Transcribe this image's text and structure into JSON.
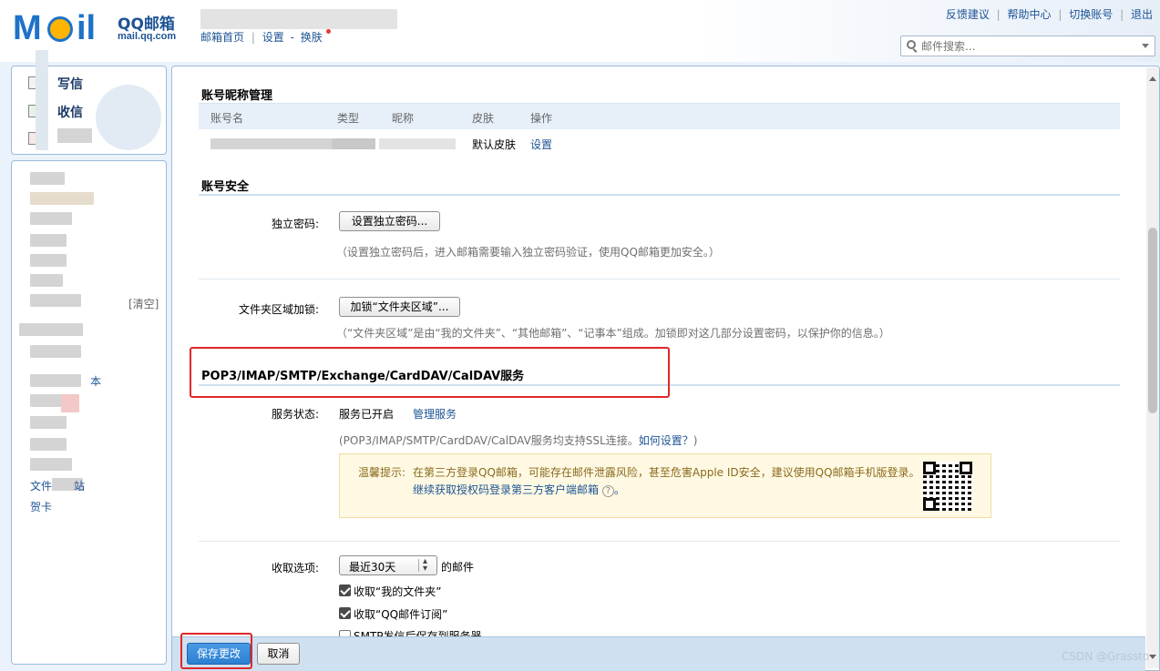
{
  "header": {
    "logo_mail": "M",
    "logo_il": "il",
    "brand": "QQ邮箱",
    "brand_domain": "mail.qq.com",
    "nav_home": "邮箱首页",
    "nav_sep": "|",
    "nav_settings": "设置",
    "nav_dash": "-",
    "nav_skin": "换肤",
    "top_links": [
      "反馈建议",
      "帮助中心",
      "切换账号",
      "退出"
    ],
    "search_placeholder": "邮件搜索..."
  },
  "sidebar": {
    "write": "写信",
    "receive": "收信",
    "clear": "[清空]",
    "notes_suffix": "本",
    "trash_prefix": "文件",
    "trash_suffix": "站",
    "greeting_card": "贺卡"
  },
  "account_nick": {
    "title": "账号昵称管理",
    "headers": [
      "账号名",
      "类型",
      "昵称",
      "皮肤",
      "操作"
    ],
    "skin": "默认皮肤",
    "action": "设置"
  },
  "security": {
    "title": "账号安全",
    "pwd_label": "独立密码:",
    "pwd_button": "设置独立密码...",
    "pwd_hint": "（设置独立密码后，进入邮箱需要输入独立密码验证，使用QQ邮箱更加安全。）",
    "lock_label": "文件夹区域加锁:",
    "lock_button": "加锁“文件夹区域”...",
    "lock_hint": "（“文件夹区域”是由“我的文件夹”、“其他邮箱”、“记事本”组成。加锁即对这几部分设置密码，以保护你的信息。）"
  },
  "pop3": {
    "title": "POP3/IMAP/SMTP/Exchange/CardDAV/CalDAV服务",
    "status_label": "服务状态:",
    "status_value": "服务已开启",
    "manage_link": "管理服务",
    "ssl_hint_prefix": "(POP3/IMAP/SMTP/CardDAV/CalDAV服务均支持SSL连接。",
    "ssl_hint_link": "如何设置？",
    "ssl_hint_suffix": ")",
    "warn_prefix": "温馨提示:",
    "warn_text": "在第三方登录QQ邮箱，可能存在邮件泄露风险，甚至危害Apple ID安全，建议使用QQ邮箱手机版登录。",
    "warn_link": "继续获取授权码登录第三方客户端邮箱",
    "warn_help": "?",
    "warn_end": "。",
    "fetch_label": "收取选项:",
    "fetch_select": "最近30天",
    "fetch_suffix": "的邮件",
    "check1": "收取“我的文件夹”",
    "check2": "收取“QQ邮件订阅”",
    "check3": "SMTP发信后保存到服务器"
  },
  "footer": {
    "save": "保存更改",
    "cancel": "取消",
    "watermark": "CSDN @Grassto"
  },
  "colors": {
    "accent": "#1e5494",
    "highlight_box": "#e02828",
    "save_button": "#2c7fd2",
    "warn_bg": "#fff9e3"
  }
}
